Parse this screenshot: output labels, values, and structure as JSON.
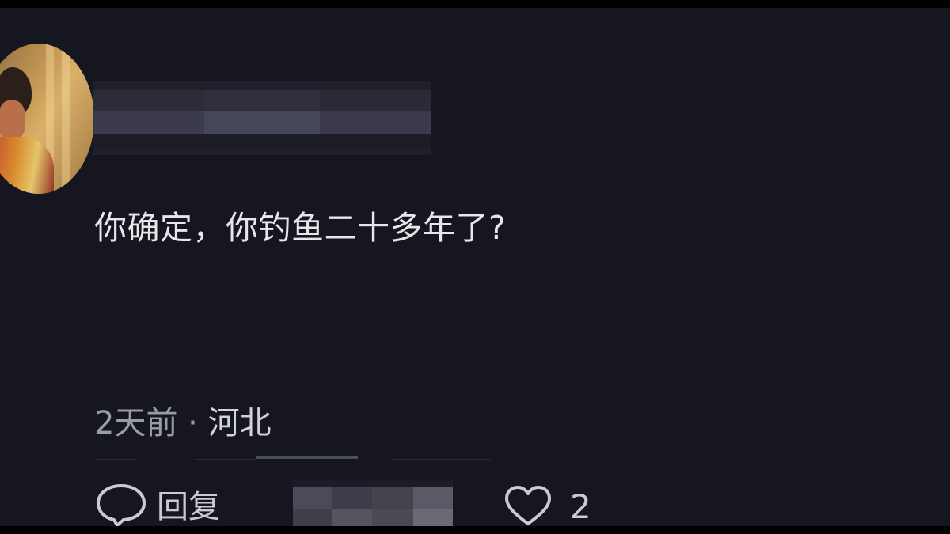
{
  "comment": {
    "text": "你确定，你钓鱼二十多年了?",
    "time": "2天前",
    "separator": "·",
    "location": "河北"
  },
  "actions": {
    "reply_label": "回复",
    "like_count": "2",
    "reply_icon": "speech-bubble-icon",
    "like_icon": "heart-outline-icon"
  },
  "colors": {
    "background": "#15161f",
    "primary_text": "#e7e7ea",
    "secondary_text": "#9a9ca6"
  }
}
